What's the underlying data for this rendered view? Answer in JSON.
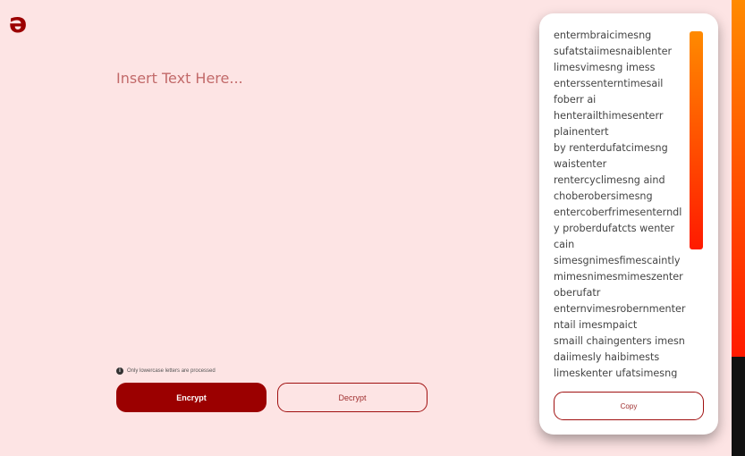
{
  "app": {
    "logo_glyph": "ə"
  },
  "input": {
    "placeholder": "Insert Text Here...",
    "value": ""
  },
  "hint": {
    "icon": "info-icon",
    "text": "Only lowercase letters are processed"
  },
  "buttons": {
    "encrypt_label": "Encrypt",
    "decrypt_label": "Decrypt",
    "copy_label": "Copy"
  },
  "output": {
    "lines": [
      "entermbraicimesng",
      "sufatstaiimesnaiblenter",
      "limesvimesng imess",
      "enterssenterntimesail",
      "foberr ai",
      "henterailthimesenterr",
      "plainentert",
      "by renterdufatcimesng",
      "waistenter",
      "rentercyclimesng aind",
      "choberobersimesng",
      "entercoberfrimesenterndl",
      "y proberdufatcts wenter",
      "cain",
      "simesgnimesfimescaintly",
      "mimesnimesmimeszenter",
      "oberufatr",
      "enternvimesrobernmenter",
      "ntail imesmpaict",
      "smaill chaingenters imesn",
      "daiimesly haibimests",
      "limeskenter ufatsimesng"
    ]
  },
  "colors": {
    "background": "#fde4e4",
    "primary": "#9b0000",
    "scrollbar_top": "#ff8a00",
    "scrollbar_bottom": "#ff1a00"
  }
}
